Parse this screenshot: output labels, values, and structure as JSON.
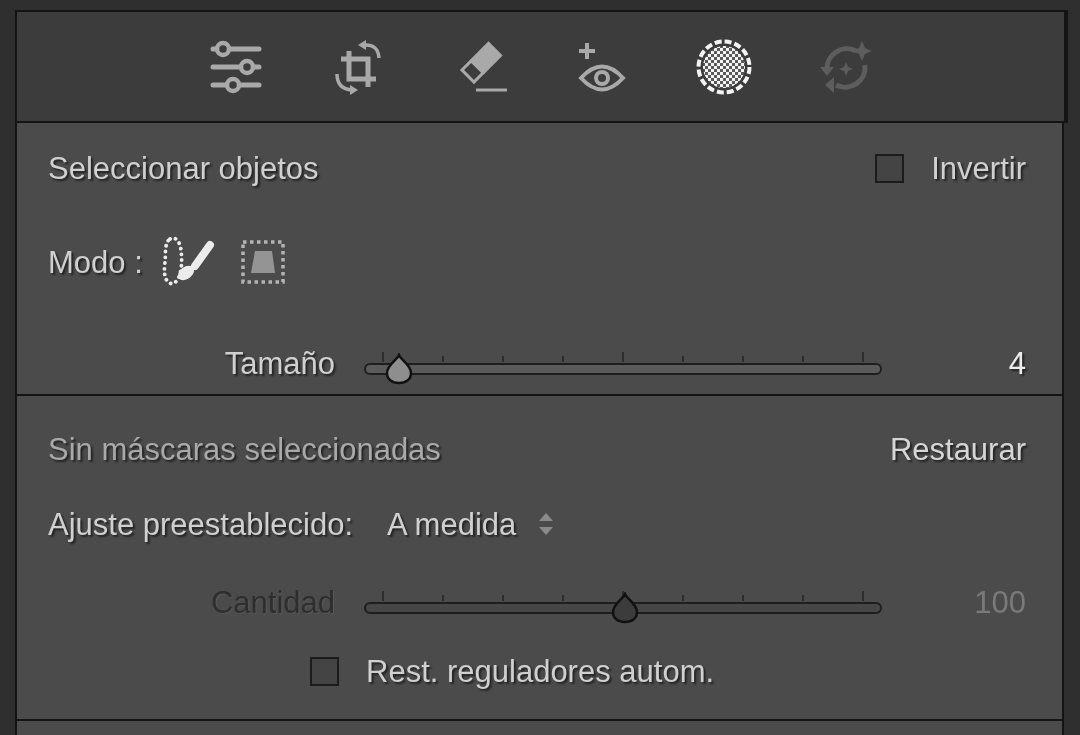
{
  "toolbar": {
    "tools": [
      {
        "kind": "sliders",
        "selected": false,
        "disabled": false
      },
      {
        "kind": "crop",
        "selected": false,
        "disabled": false
      },
      {
        "kind": "eraser",
        "selected": false,
        "disabled": false
      },
      {
        "kind": "eye",
        "selected": false,
        "disabled": false
      },
      {
        "kind": "mask",
        "selected": true,
        "disabled": false
      },
      {
        "kind": "heal",
        "selected": false,
        "disabled": true
      }
    ]
  },
  "object_selection": {
    "title": "Seleccionar objetos",
    "invert": {
      "label": "Invertir",
      "checked": false
    },
    "mode": {
      "label": "Modo :",
      "options": [
        {
          "kind": "brush",
          "selected": true
        },
        {
          "kind": "rectangle",
          "selected": false
        }
      ]
    },
    "size": {
      "label": "Tamaño",
      "level": 0.03,
      "reading": "4",
      "disabled": false
    }
  },
  "masks": {
    "status": "Sin máscaras seleccionadas",
    "reset_button": "Restaurar",
    "preset": {
      "label": "Ajuste preestablecido:",
      "value": "A medida"
    },
    "amount": {
      "label": "Cantidad",
      "level": 0.5,
      "reading": "100",
      "disabled": true
    },
    "auto_reset": {
      "label": "Rest. reguladores autom.",
      "checked": false
    }
  }
}
